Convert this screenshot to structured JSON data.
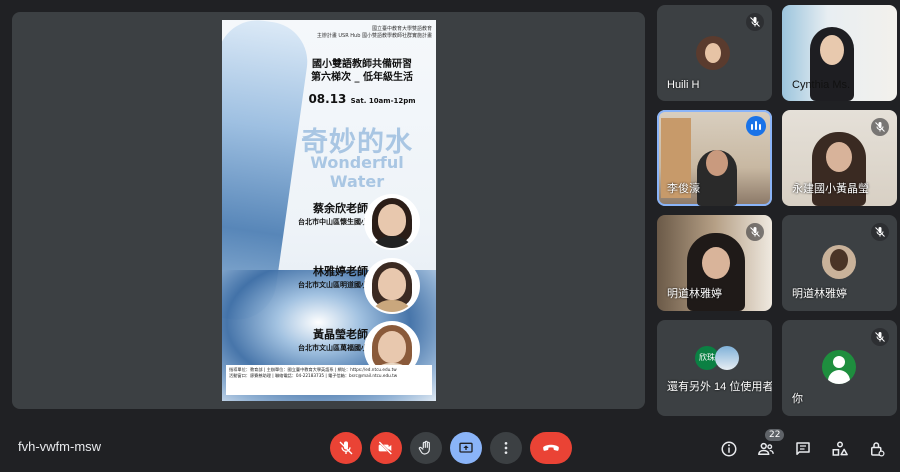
{
  "meeting": {
    "code": "fvh-vwfm-msw",
    "participant_count": "22"
  },
  "presentation": {
    "org_line1": "國立臺中教育大學雙語教育",
    "org_line2": "主辦計畫 USR Hub 國小雙語教學教師社群實施計畫",
    "title_line1": "國小雙語教師共備研習",
    "title_line2": "第六梯次 _ 低年級生活",
    "date": "08.13",
    "time": "Sat. 10am-12pm",
    "title_cn": "奇妙的水",
    "title_en": "Wonderful Water",
    "teachers": [
      {
        "name": "蔡余欣老師",
        "school": "台北市中山區懷生國小"
      },
      {
        "name": "林雅婷老師",
        "school": "台北市文山區明道國小"
      },
      {
        "name": "黃晶瑩老師",
        "school": "台北市文山區萬福國小"
      }
    ],
    "footer_line1": "指導單位：教育部 | 主辦單位：國立臺中教育大學英語系 | 網址：https://ed.ntcu.edu.tw",
    "footer_line2": "活動窗口：廖賽慈助理 | 聯絡電話：04-22183735 | 電子信箱：bsrc@mail.ntcu.edu.tw"
  },
  "participants": [
    {
      "name": "Huili H"
    },
    {
      "name": "Cynthia Ms."
    },
    {
      "name": "李俊濠"
    },
    {
      "name": "永建國小黃晶瑩"
    },
    {
      "name": "明道林雅婷"
    },
    {
      "name": "明道林雅婷"
    },
    {
      "name": "還有另外 14 位使用者",
      "mini_label": "欣珠"
    },
    {
      "name": "你"
    }
  ],
  "colors": {
    "accent": "#8ab4f8",
    "danger": "#ea4335",
    "tile": "#3c4043",
    "background": "#202124"
  },
  "controls": {
    "left": [
      "mic-off-icon",
      "camera-off-icon",
      "raise-hand-icon",
      "present-icon",
      "more-options-icon",
      "end-call-icon"
    ],
    "right": [
      "info-icon",
      "people-icon",
      "chat-icon",
      "activities-icon",
      "host-controls-icon"
    ]
  }
}
